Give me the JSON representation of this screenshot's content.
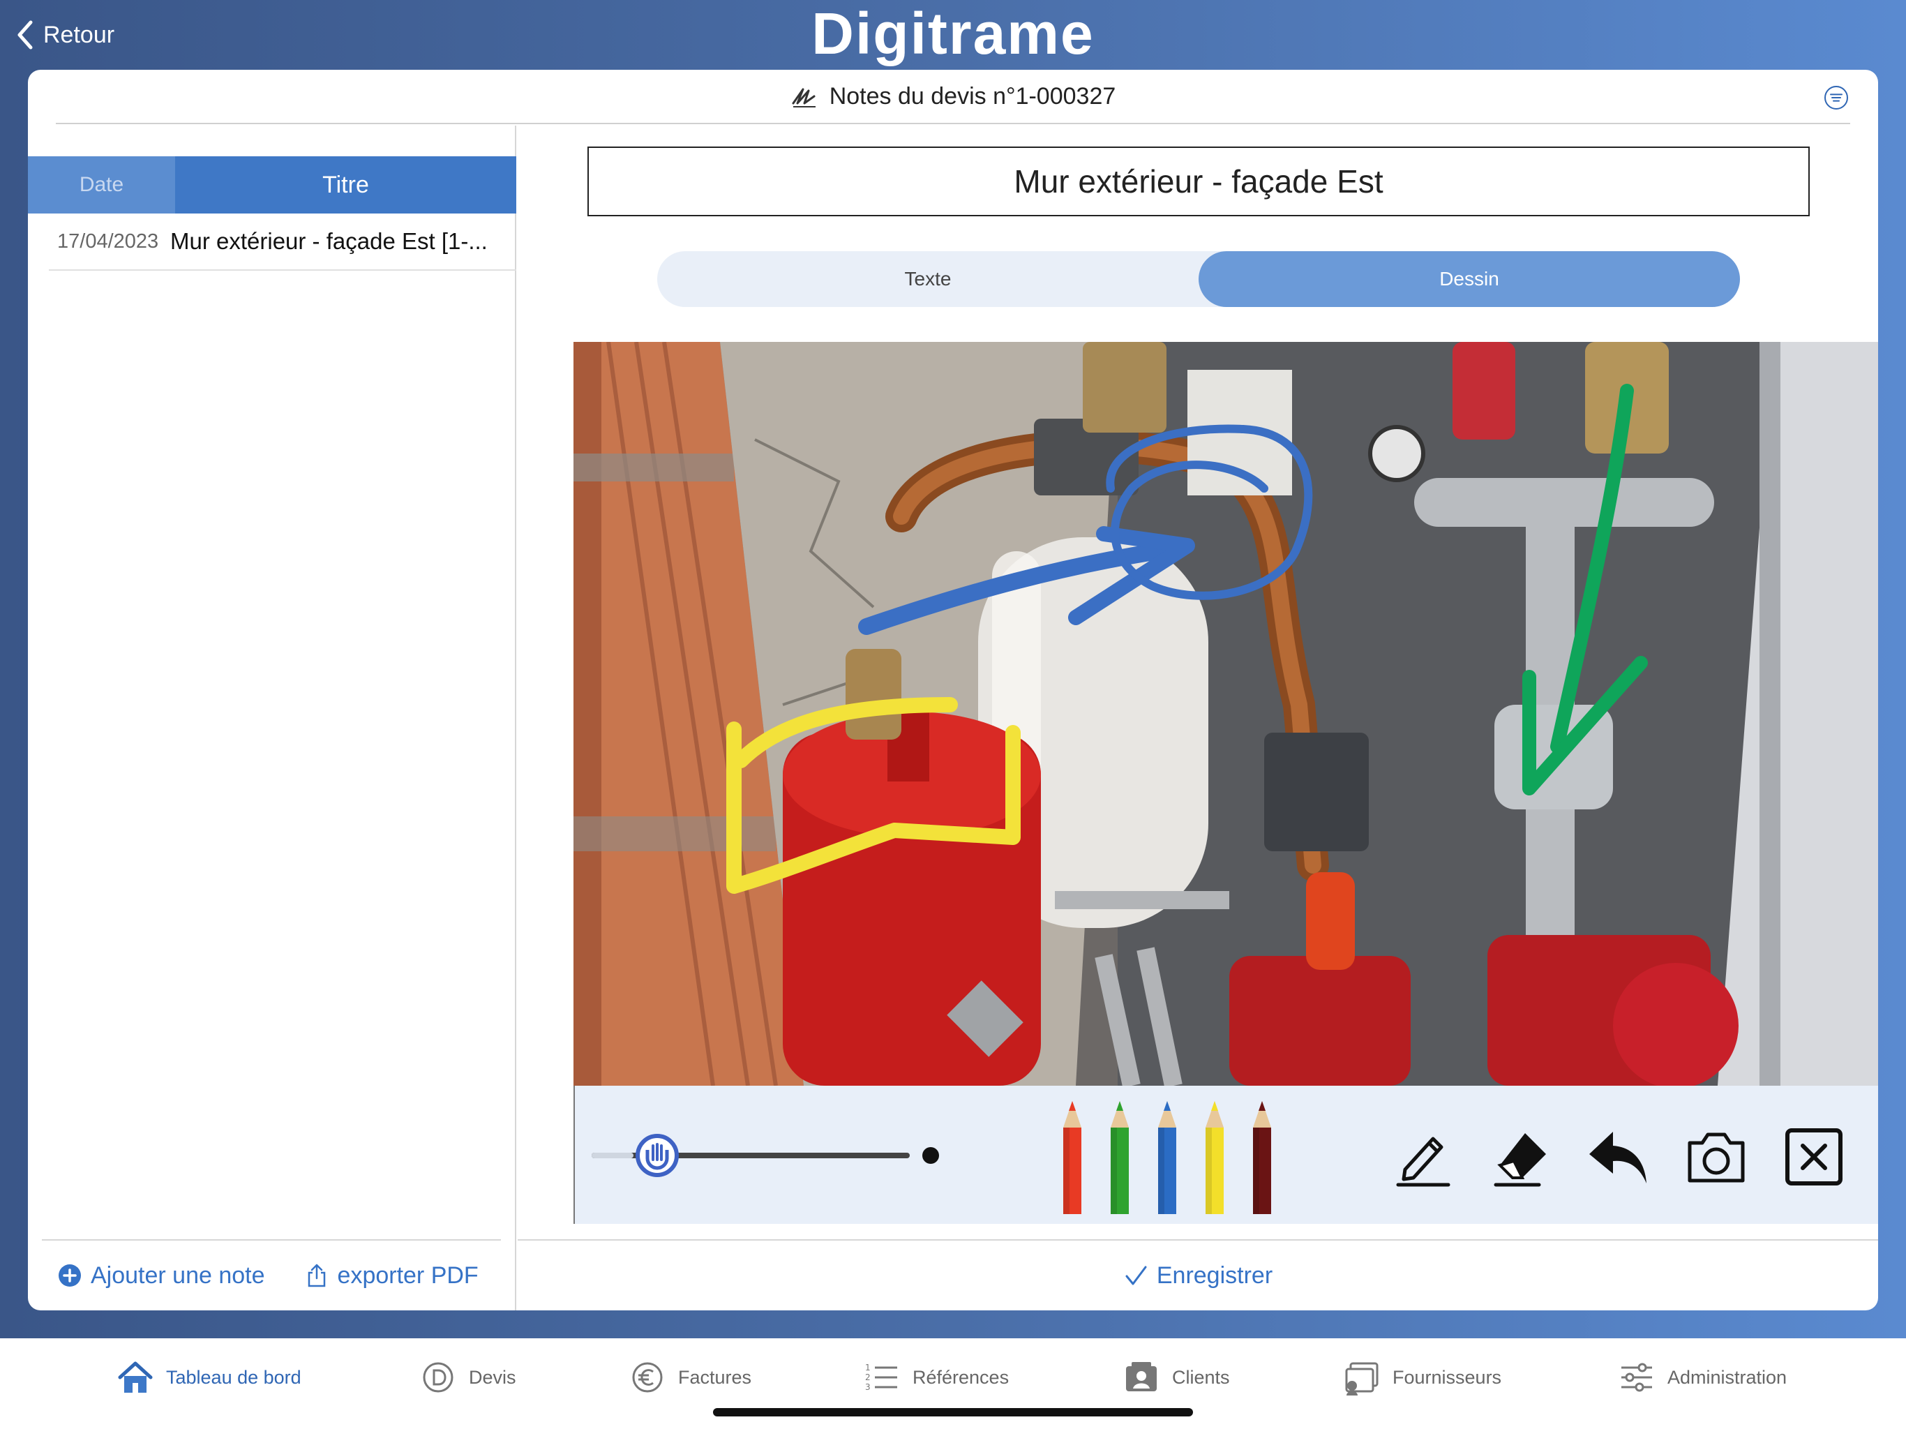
{
  "app": {
    "brand": "Digitrame",
    "back_label": "Retour"
  },
  "header": {
    "title": "Notes du devis n°1-000327"
  },
  "notes_list": {
    "columns": {
      "date": "Date",
      "title": "Titre"
    },
    "rows": [
      {
        "date": "17/04/2023",
        "title": "Mur extérieur - façade Est [1-..."
      }
    ],
    "add_label": "Ajouter une note",
    "export_label": "exporter PDF"
  },
  "editor": {
    "note_title": "Mur extérieur - façade Est",
    "modes": {
      "text": "Texte",
      "drawing": "Dessin",
      "active": "drawing"
    },
    "pencil_colors": [
      "#e83a24",
      "#2fa32f",
      "#2b6cc4",
      "#f3df2a",
      "#6a1414"
    ],
    "tools": [
      "pen-icon",
      "eraser-icon",
      "undo-icon",
      "camera-icon",
      "close-icon"
    ],
    "brush_size": 0.12,
    "save_label": "Enregistrer"
  },
  "tabbar": {
    "items": [
      {
        "label": "Tableau de bord",
        "icon": "home-icon",
        "active": true
      },
      {
        "label": "Devis",
        "icon": "quote-icon"
      },
      {
        "label": "Factures",
        "icon": "euro-icon"
      },
      {
        "label": "Références",
        "icon": "list-icon"
      },
      {
        "label": "Clients",
        "icon": "clients-icon"
      },
      {
        "label": "Fournisseurs",
        "icon": "suppliers-icon"
      },
      {
        "label": "Administration",
        "icon": "sliders-icon"
      }
    ]
  }
}
